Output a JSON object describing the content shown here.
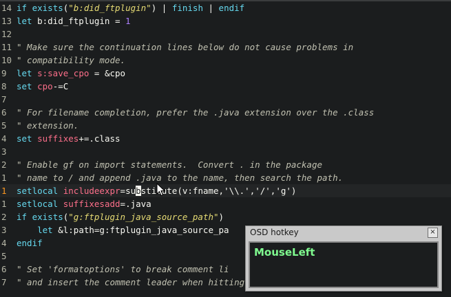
{
  "editor": {
    "cursor_line_index": 14,
    "lines": [
      {
        "num": "14",
        "segments": [
          {
            "c": "kw",
            "t": "if"
          },
          {
            "c": "plain",
            "t": " "
          },
          {
            "c": "kw",
            "t": "exists"
          },
          {
            "c": "plain",
            "t": "("
          },
          {
            "c": "str",
            "t": "\"b:did_ftplugin\""
          },
          {
            "c": "plain",
            "t": ") | "
          },
          {
            "c": "kw",
            "t": "finish"
          },
          {
            "c": "plain",
            "t": " | "
          },
          {
            "c": "kw",
            "t": "endif"
          }
        ]
      },
      {
        "num": "13",
        "segments": [
          {
            "c": "kw",
            "t": "let"
          },
          {
            "c": "plain",
            "t": " b:did_ftplugin = "
          },
          {
            "c": "num",
            "t": "1"
          }
        ]
      },
      {
        "num": "12",
        "segments": []
      },
      {
        "num": "11",
        "segments": [
          {
            "c": "cmt",
            "t": "\" Make sure the continuation lines below do not cause problems in"
          }
        ]
      },
      {
        "num": "10",
        "segments": [
          {
            "c": "cmt",
            "t": "\" compatibility mode."
          }
        ]
      },
      {
        "num": "9",
        "segments": [
          {
            "c": "kw",
            "t": "let"
          },
          {
            "c": "plain",
            "t": " "
          },
          {
            "c": "opt",
            "t": "s:save_cpo"
          },
          {
            "c": "plain",
            "t": " = &cpo"
          }
        ]
      },
      {
        "num": "8",
        "segments": [
          {
            "c": "kw",
            "t": "set"
          },
          {
            "c": "plain",
            "t": " "
          },
          {
            "c": "opt",
            "t": "cpo"
          },
          {
            "c": "plain",
            "t": "-=C"
          }
        ]
      },
      {
        "num": "7",
        "segments": []
      },
      {
        "num": "6",
        "segments": [
          {
            "c": "cmt",
            "t": "\" For filename completion, prefer the .java extension over the .class"
          }
        ]
      },
      {
        "num": "5",
        "segments": [
          {
            "c": "cmt",
            "t": "\" extension."
          }
        ]
      },
      {
        "num": "4",
        "segments": [
          {
            "c": "kw",
            "t": "set"
          },
          {
            "c": "plain",
            "t": " "
          },
          {
            "c": "opt",
            "t": "suffixes"
          },
          {
            "c": "plain",
            "t": "+=.class"
          }
        ]
      },
      {
        "num": "3",
        "segments": []
      },
      {
        "num": "2",
        "segments": [
          {
            "c": "cmt",
            "t": "\" Enable gf on import statements.  Convert . in the package"
          }
        ]
      },
      {
        "num": "1",
        "segments": [
          {
            "c": "cmt",
            "t": "\" name to / and append .java to the name, then search the path."
          }
        ]
      },
      {
        "num": "1",
        "segments": [
          {
            "c": "kw",
            "t": "setlocal"
          },
          {
            "c": "plain",
            "t": " "
          },
          {
            "c": "opt",
            "t": "includeexpr"
          },
          {
            "c": "plain",
            "t": "=su"
          },
          {
            "c": "cursor",
            "t": "b"
          },
          {
            "c": "plain",
            "t": "stitute(v:fname,'\\\\.','/','g')"
          }
        ]
      },
      {
        "num": "1",
        "segments": [
          {
            "c": "kw",
            "t": "setlocal"
          },
          {
            "c": "plain",
            "t": " "
          },
          {
            "c": "opt",
            "t": "suffixesadd"
          },
          {
            "c": "plain",
            "t": "=.java"
          }
        ]
      },
      {
        "num": "2",
        "segments": [
          {
            "c": "kw",
            "t": "if"
          },
          {
            "c": "plain",
            "t": " "
          },
          {
            "c": "kw",
            "t": "exists"
          },
          {
            "c": "plain",
            "t": "("
          },
          {
            "c": "str",
            "t": "\"g:ftplugin_java_source_path\""
          },
          {
            "c": "plain",
            "t": ")"
          }
        ]
      },
      {
        "num": "3",
        "segments": [
          {
            "c": "plain",
            "t": "    "
          },
          {
            "c": "kw",
            "t": "let"
          },
          {
            "c": "plain",
            "t": " &l:path=g:ftplugin_java_source_pa"
          }
        ]
      },
      {
        "num": "4",
        "segments": [
          {
            "c": "kw",
            "t": "endif"
          }
        ]
      },
      {
        "num": "5",
        "segments": []
      },
      {
        "num": "6",
        "segments": [
          {
            "c": "cmt",
            "t": "\" Set 'formatoptions' to break comment li"
          }
        ]
      },
      {
        "num": "7",
        "segments": [
          {
            "c": "cmt",
            "t": "\" and insert the comment leader when hitting <CR> or using \"o\"."
          }
        ]
      }
    ]
  },
  "osd": {
    "title": "OSD hotkey",
    "close_glyph": "×",
    "key": "MouseLeft"
  },
  "colors": {
    "background": "#1b1d1e",
    "keyword": "#66d9ef",
    "string": "#e6db74",
    "comment": "#c0c0b0",
    "number": "#ae81ff",
    "option": "#fd6f8a",
    "osd_text": "#7ffa8f"
  }
}
